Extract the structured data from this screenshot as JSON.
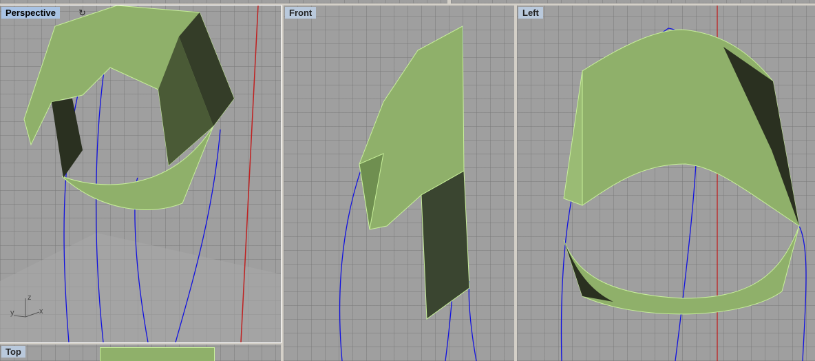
{
  "viewports": [
    {
      "label": "Perspective",
      "active": true
    },
    {
      "label": "Front"
    },
    {
      "label": "Left"
    },
    {
      "label": "Top"
    }
  ],
  "axes": {
    "x": "x",
    "y": "y",
    "z": "z"
  },
  "colors": {
    "surface": "#8fb06a",
    "edge": "#c8f09a",
    "curve": "#1010e0",
    "axis_red": "#c02020"
  }
}
